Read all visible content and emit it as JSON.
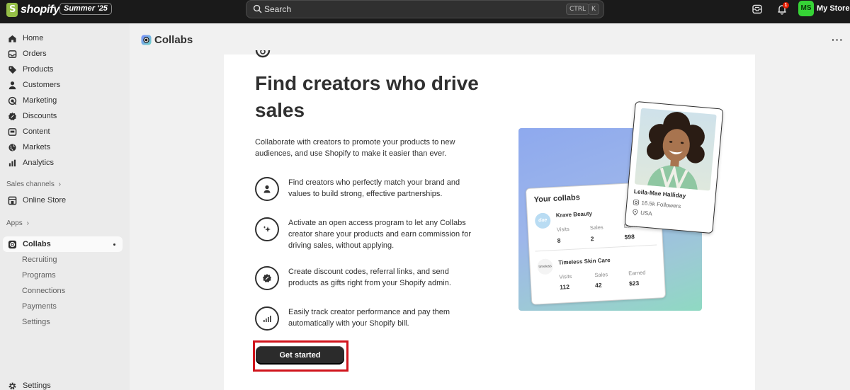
{
  "topbar": {
    "logo_text": "shopify",
    "edition_badge": "Summer '25",
    "search_placeholder": "Search",
    "shortcut_keys": [
      "CTRL",
      "K"
    ],
    "notification_count": "1",
    "avatar_initials": "MS",
    "store_name": "My Store",
    "colors": {
      "bar": "#1a1a1a",
      "avatar": "#36d336",
      "badge": "#e51c00"
    }
  },
  "sidebar": {
    "items": [
      {
        "label": "Home",
        "icon": "home-icon"
      },
      {
        "label": "Orders",
        "icon": "orders-icon"
      },
      {
        "label": "Products",
        "icon": "tag-icon"
      },
      {
        "label": "Customers",
        "icon": "person-icon"
      },
      {
        "label": "Marketing",
        "icon": "target-icon"
      },
      {
        "label": "Discounts",
        "icon": "discount-icon"
      },
      {
        "label": "Content",
        "icon": "content-icon"
      },
      {
        "label": "Markets",
        "icon": "globe-icon"
      },
      {
        "label": "Analytics",
        "icon": "bar-chart-icon"
      }
    ],
    "sales_channels_label": "Sales channels",
    "online_store_label": "Online Store",
    "apps_label": "Apps",
    "collabs_label": "Collabs",
    "collabs_subitems": [
      "Recruiting",
      "Programs",
      "Connections",
      "Payments",
      "Settings"
    ],
    "settings_label": "Settings"
  },
  "main": {
    "page_title": "Collabs",
    "more_label": "···",
    "headline": "Find creators who drive sales",
    "intro": "Collaborate with creators to promote your products to new audiences, and use Shopify to make it easier than ever.",
    "features": [
      {
        "icon": "person-icon",
        "text": "Find creators who perfectly match your brand and values to build strong, effective partnerships."
      },
      {
        "icon": "sparkle-icon",
        "text": "Activate an open access program to let any Collabs creator share your products and earn commission for driving sales, without applying."
      },
      {
        "icon": "discount-badge-icon",
        "text": "Create discount codes, referral links, and send products as gifts right from your Shopify admin."
      },
      {
        "icon": "signal-bars-icon",
        "text": "Easily track creator performance and pay them automatically with your Shopify bill."
      }
    ],
    "cta_label": "Get started",
    "cta_highlight_color": "#d0141c"
  },
  "illustration": {
    "collabs_card": {
      "title": "Your collabs",
      "rows": [
        {
          "logo": "dae",
          "brand": "Krave Beauty",
          "visits_label": "Visits",
          "visits": "8",
          "sales_label": "Sales",
          "sales": "2",
          "earned_label": "Earned",
          "earned": "$98"
        },
        {
          "logo": "timeless",
          "brand": "Timeless Skin Care",
          "visits_label": "Visits",
          "visits": "112",
          "sales_label": "Sales",
          "sales": "42",
          "earned_label": "Earned",
          "earned": "$23"
        }
      ]
    },
    "creator_card": {
      "name": "Leila-Mae Halliday",
      "followers": "16.5k Followers",
      "location": "USA"
    }
  }
}
